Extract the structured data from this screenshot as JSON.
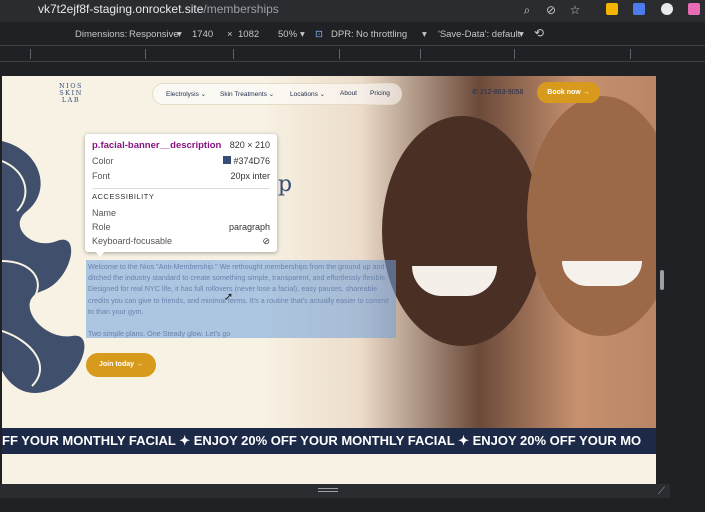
{
  "browser": {
    "url_host": "vk7t2ejf8f-staging.onrocket.site",
    "url_path": "/memberships"
  },
  "devtools": {
    "dimensions_label": "Dimensions:",
    "dimensions_value": "Responsive",
    "width": "1740",
    "times": "×",
    "height": "1082",
    "zoom": "50%",
    "dpr": "DPR:",
    "throttle": "No throttling",
    "save_data": "'Save-Data': default"
  },
  "site": {
    "logo_lines": [
      "NIOS",
      "SKIN",
      "LAB"
    ],
    "nav": [
      "Electrolysis",
      "Skin Treatments",
      "Locations",
      "About",
      "Pricing"
    ],
    "phone": "212-863-9058",
    "book": "Book now",
    "heading_fragment": "p",
    "description_p1": "Welcome to the Nios \"Anti-Membership.\" We rethought memberships from the ground up and ditched the industry standard to create something simple, transparent, and effortlessly flexible. Designed for real NYC life, it has full rollovers (never lose a facial), easy pauses, shareable credits you can give to friends, and minimal terms. It's a routine that's actually easier to commit to than your gym.",
    "description_p2": "Two simple plans. One Steady glow. Let's go",
    "join": "Join today",
    "marquee": "FF YOUR MONTHLY FACIAL   ✦   ENJOY 20% OFF YOUR MONTHLY FACIAL   ✦   ENJOY 20% OFF YOUR MO"
  },
  "tooltip": {
    "selector": "p.facial-banner__description",
    "size": "820 × 210",
    "color_label": "Color",
    "color_value": "#374D76",
    "font_label": "Font",
    "font_value": "20px inter",
    "accessibility": "ACCESSIBILITY",
    "name_label": "Name",
    "role_label": "Role",
    "role_value": "paragraph",
    "kbd_label": "Keyboard-focusable"
  },
  "colors": {
    "brand_navy": "#374D76",
    "accent_gold": "#d89a1c",
    "page_bg": "#f7f2e4"
  }
}
